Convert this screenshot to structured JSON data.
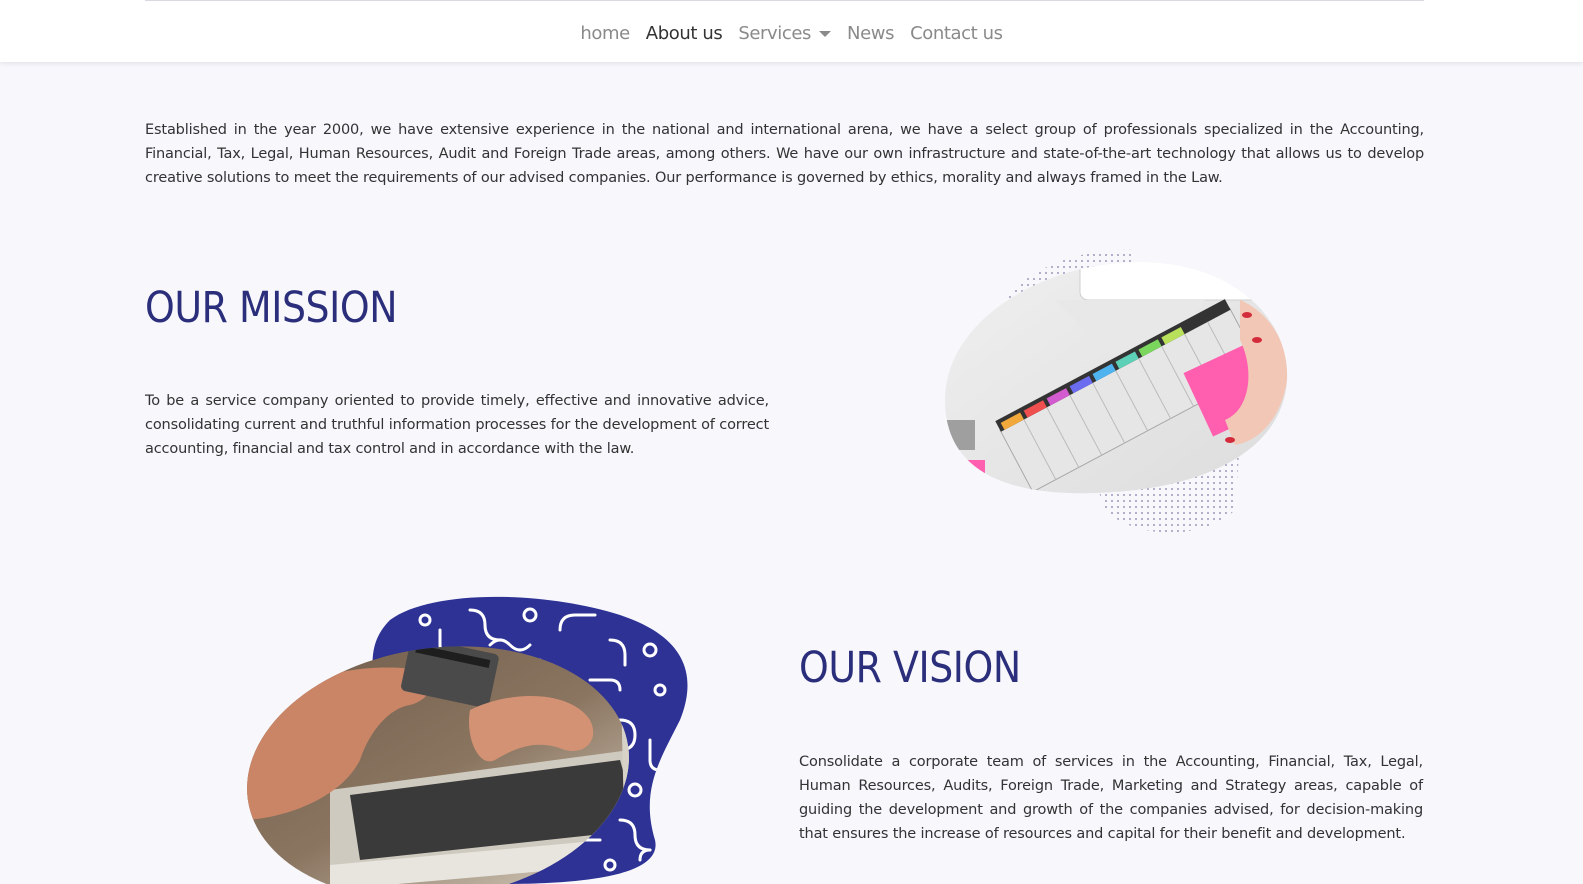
{
  "nav": {
    "items": [
      {
        "label": "home"
      },
      {
        "label": "About us"
      },
      {
        "label": "Services"
      },
      {
        "label": "News"
      },
      {
        "label": "Contact us"
      }
    ]
  },
  "intro": {
    "text": "Established in the year 2000, we have extensive experience in the national and international arena, we have a select group of professionals specialized in the Accounting, Financial, Tax, Legal, Human Resources, Audit and Foreign Trade areas, among others. We have our own infrastructure and state-of-the-art technology that allows us to develop creative solutions to meet the requirements of our advised companies. Our performance is governed by ethics, morality and always framed in the Law."
  },
  "mission": {
    "title": "OUR MISSION",
    "text": "To be a service company oriented to provide timely, effective and innovative advice, consolidating current and truthful information processes for the development of correct accounting, financial and tax control and in accordance with the law."
  },
  "vision": {
    "title": "OUR VISION",
    "text": "Consolidate a corporate team of services in the Accounting, Financial, Tax, Legal, Human Resources, Audits, Foreign Trade, Marketing and Strategy areas, capable of guiding the development and growth of the companies advised, for decision-making that ensures the increase of resources and capital for their benefit and development."
  },
  "colors": {
    "accent": "#2b2e7a",
    "pattern_blue": "#2d3294",
    "background": "#f7f7fc"
  }
}
